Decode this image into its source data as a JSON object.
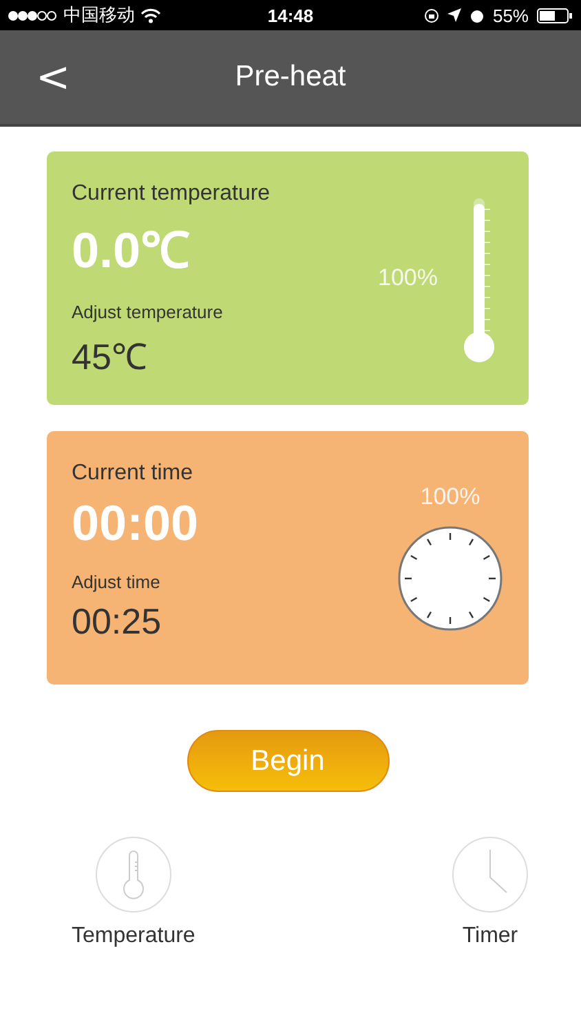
{
  "status_bar": {
    "carrier": "中国移动",
    "time": "14:48",
    "battery": "55%"
  },
  "nav": {
    "back": "<",
    "title": "Pre-heat"
  },
  "temperature_card": {
    "label": "Current temperature",
    "value": "0.0℃",
    "adjust_label": "Adjust temperature",
    "adjust_value": "45℃",
    "percent": "100%"
  },
  "time_card": {
    "label": "Current time",
    "value": "00:00",
    "adjust_label": "Adjust time",
    "adjust_value": "00:25",
    "percent": "100%"
  },
  "begin_button": "Begin",
  "bottom_tabs": [
    {
      "kind": "thermometer",
      "label": "Temperature"
    },
    {
      "kind": "clock",
      "label": "Timer"
    }
  ]
}
